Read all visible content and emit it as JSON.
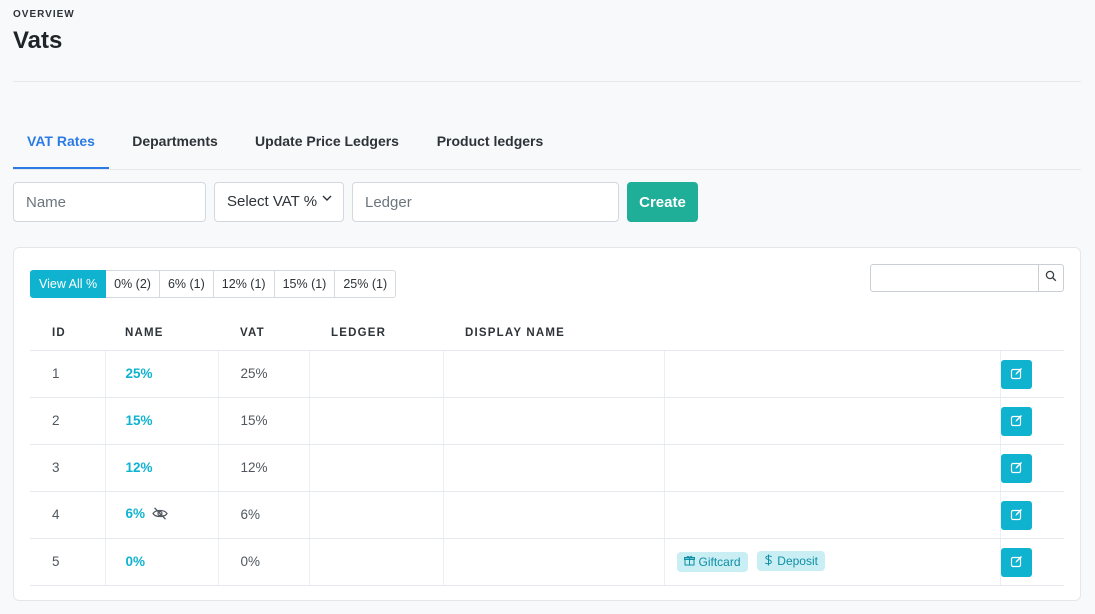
{
  "header": {
    "overline": "OVERVIEW",
    "title": "Vats"
  },
  "tabs": [
    {
      "label": "VAT Rates",
      "active": true
    },
    {
      "label": "Departments",
      "active": false
    },
    {
      "label": "Update Price Ledgers",
      "active": false
    },
    {
      "label": "Product ledgers",
      "active": false
    }
  ],
  "form": {
    "name_placeholder": "Name",
    "vat_select": "Select VAT %",
    "ledger_placeholder": "Ledger",
    "create_label": "Create"
  },
  "filters": [
    {
      "label": "View All %",
      "active": true
    },
    {
      "label": "0% (2)",
      "active": false
    },
    {
      "label": "6% (1)",
      "active": false
    },
    {
      "label": "12% (1)",
      "active": false
    },
    {
      "label": "15% (1)",
      "active": false
    },
    {
      "label": "25% (1)",
      "active": false
    }
  ],
  "search": {
    "value": ""
  },
  "table": {
    "columns": [
      "ID",
      "NAME",
      "VAT",
      "LEDGER",
      "DISPLAY NAME"
    ],
    "rows": [
      {
        "id": "1",
        "name": "25%",
        "vat": "25%",
        "ledger": "",
        "display_name": "",
        "hidden": false,
        "tags": []
      },
      {
        "id": "2",
        "name": "15%",
        "vat": "15%",
        "ledger": "",
        "display_name": "",
        "hidden": false,
        "tags": []
      },
      {
        "id": "3",
        "name": "12%",
        "vat": "12%",
        "ledger": "",
        "display_name": "",
        "hidden": false,
        "tags": []
      },
      {
        "id": "4",
        "name": "6%",
        "vat": "6%",
        "ledger": "",
        "display_name": "",
        "hidden": true,
        "tags": []
      },
      {
        "id": "5",
        "name": "0%",
        "vat": "0%",
        "ledger": "",
        "display_name": "",
        "hidden": false,
        "tags": [
          {
            "label": "Giftcard",
            "icon": "gift-icon"
          },
          {
            "label": "Deposit",
            "icon": "dollar-icon"
          }
        ]
      }
    ]
  },
  "colors": {
    "accent": "#0fb3cf",
    "tab_active": "#2c7be5",
    "create_button": "#1fae97",
    "tag_bg": "#c9eef4"
  }
}
